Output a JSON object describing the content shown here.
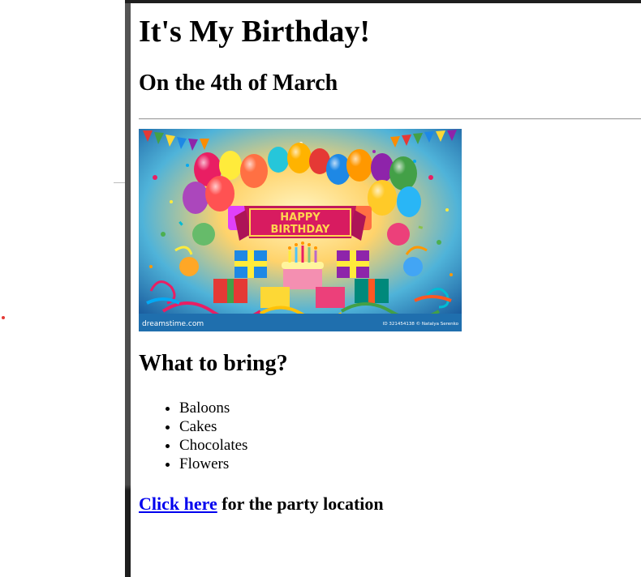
{
  "page": {
    "title": "It's My Birthday!",
    "date_heading": "On the 4th of March"
  },
  "banner": {
    "main_text_line1": "HAPPY",
    "main_text_line2": "BIRTHDAY",
    "watermark_left": "dreamstime.com",
    "watermark_right": "ID 321454138 © Natalya Serenko",
    "colors": {
      "background_center": "#fff3b0",
      "background_edge": "#1e6fb5",
      "footer": "#1f6fae",
      "ribbon": "#d81b60",
      "ribbon_text": "#ffd54f"
    }
  },
  "bring": {
    "heading": "What to bring?",
    "items": [
      "Baloons",
      "Cakes",
      "Chocolates",
      "Flowers"
    ]
  },
  "party": {
    "link_text": "Click here",
    "suffix_text": " for the party location",
    "link_color": "#0000ee"
  }
}
